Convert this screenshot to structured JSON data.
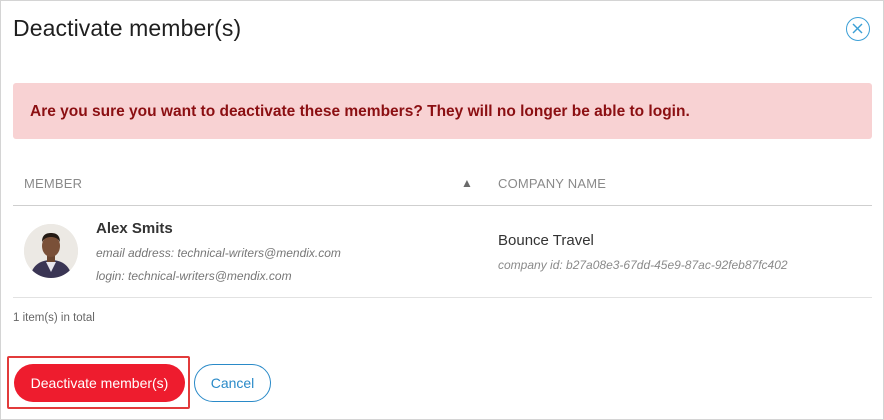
{
  "dialog": {
    "title": "Deactivate member(s)",
    "close_icon": "close-circle-icon"
  },
  "alert": {
    "message": "Are you sure you want to deactivate these members? They will no longer be able to login."
  },
  "table": {
    "columns": [
      "MEMBER",
      "COMPANY NAME"
    ],
    "sort_icon": "sort-ascending-icon",
    "rows": [
      {
        "member_name": "Alex Smits",
        "email": "email address: technical-writers@mendix.com",
        "login": "login: technical-writers@mendix.com",
        "company_name": "Bounce Travel",
        "company_id": "company id: b27a08e3-67dd-45e9-87ac-92feb87fc402"
      }
    ],
    "total": "1 item(s) in total"
  },
  "actions": {
    "deactivate_label": "Deactivate member(s)",
    "cancel_label": "Cancel"
  },
  "colors": {
    "accent_blue": "#2a8ac8",
    "danger_red": "#ee1c2e",
    "alert_bg": "#f8d2d3",
    "alert_text": "#8b0f12"
  }
}
